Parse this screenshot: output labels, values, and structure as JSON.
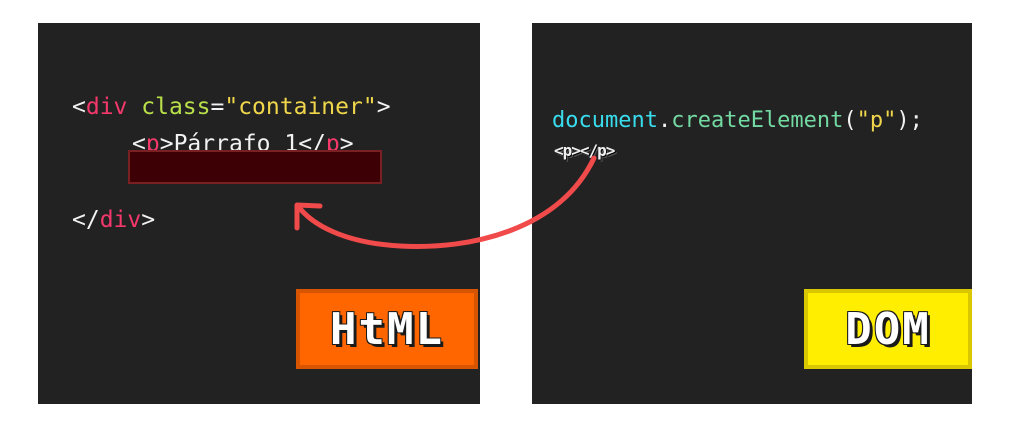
{
  "html_panel": {
    "line1": {
      "open": "<",
      "tag": "div",
      "attr": " class",
      "eq": "=",
      "value": "\"container\"",
      "close": ">"
    },
    "line2": {
      "open": "<",
      "tag": "p",
      "mid": ">Párrafo 1</",
      "tag2": "p",
      "close": ">"
    },
    "line4": {
      "open": "</",
      "tag": "div",
      "close": ">"
    },
    "badge": "HtML"
  },
  "dom_panel": {
    "code": {
      "object": "document",
      "dot": ".",
      "method": "createElement",
      "args_open": "(",
      "arg": "\"p\"",
      "args_close": ");"
    },
    "element_label": "<p></p>",
    "badge": "DOM"
  },
  "colors": {
    "tag": "#f5386b",
    "attribute": "#b8e04a",
    "string": "#f0d64a",
    "object": "#38dced",
    "method": "#73d9a2",
    "arrow": "#f04a4a",
    "html_badge": "#ff6600",
    "dom_badge": "#ffee00",
    "panel": "#222222"
  }
}
